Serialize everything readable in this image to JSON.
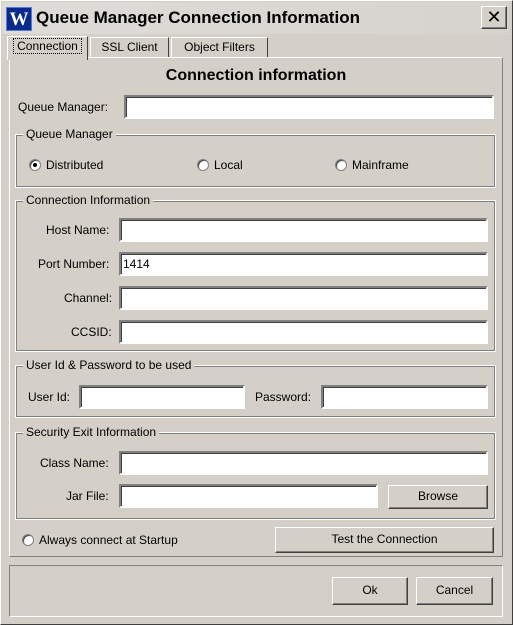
{
  "window": {
    "title": "Queue Manager Connection Information",
    "icon_letter": "W"
  },
  "tabs": [
    {
      "label": "Connection",
      "active": true
    },
    {
      "label": "SSL Client"
    },
    {
      "label": "Object Filters"
    }
  ],
  "panel": {
    "heading": "Connection information",
    "queue_manager": {
      "label": "Queue Manager:",
      "value": ""
    }
  },
  "qm_type": {
    "legend": "Queue Manager",
    "options": [
      {
        "label": "Distributed",
        "selected": true
      },
      {
        "label": "Local",
        "selected": false
      },
      {
        "label": "Mainframe",
        "selected": false
      }
    ]
  },
  "connection": {
    "legend": "Connection Information",
    "host": {
      "label": "Host Name:",
      "value": ""
    },
    "port": {
      "label": "Port Number:",
      "value": "1414"
    },
    "channel": {
      "label": "Channel:",
      "value": ""
    },
    "ccsid": {
      "label": "CCSID:",
      "value": ""
    }
  },
  "credentials": {
    "legend": "User Id & Password to be used",
    "user": {
      "label": "User Id:",
      "value": ""
    },
    "password": {
      "label": "Password:",
      "value": ""
    }
  },
  "security": {
    "legend": "Security Exit Information",
    "class_name": {
      "label": "Class Name:",
      "value": ""
    },
    "jar_file": {
      "label": "Jar File:",
      "value": ""
    },
    "browse_label": "Browse"
  },
  "startup": {
    "label": "Always connect at Startup",
    "selected": false
  },
  "test_label": "Test the Connection",
  "ok_label": "Ok",
  "cancel_label": "Cancel",
  "icons": {
    "close": "close-icon",
    "app": "app-icon"
  }
}
